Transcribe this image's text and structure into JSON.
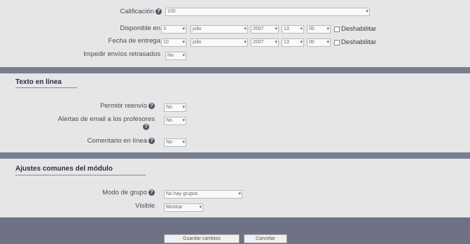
{
  "general": {
    "grade_label": "Calificación",
    "grade_value": "100",
    "available_from_label": "Disponible en",
    "available_from": {
      "day": "3",
      "month": "julio",
      "year": "2007",
      "hour": "13",
      "minute": "00",
      "disable_label": "Deshabilitar"
    },
    "due_date_label": "Fecha de entrega",
    "due_date": {
      "day": "10",
      "month": "julio",
      "year": "2007",
      "hour": "13",
      "minute": "00",
      "disable_label": "Deshabilitar"
    },
    "prevent_late_label": "Impedir envíos retrasados",
    "prevent_late_value": "No"
  },
  "online_text": {
    "heading": "Texto en línea",
    "resubmit_label": "Permitir reenvío",
    "resubmit_value": "No",
    "email_alerts_label": "Alertas de email a los profesores",
    "email_alerts_value": "No",
    "inline_comment_label": "Comentario en línea",
    "inline_comment_value": "No"
  },
  "module_settings": {
    "heading": "Ajustes comunes del módulo",
    "group_mode_label": "Modo de grupo",
    "group_mode_value": "No hay grupos",
    "visible_label": "Visible",
    "visible_value": "Mostrar"
  },
  "footer": {
    "save_label": "Guardar cambios",
    "cancel_label": "Cancelar"
  },
  "icons": {
    "help": "help-icon",
    "dropdown": "chevron-down-icon"
  },
  "colors": {
    "separator_bar": "#7a7d8e",
    "background": "#e6e6e6",
    "footer": "#6f7284"
  }
}
